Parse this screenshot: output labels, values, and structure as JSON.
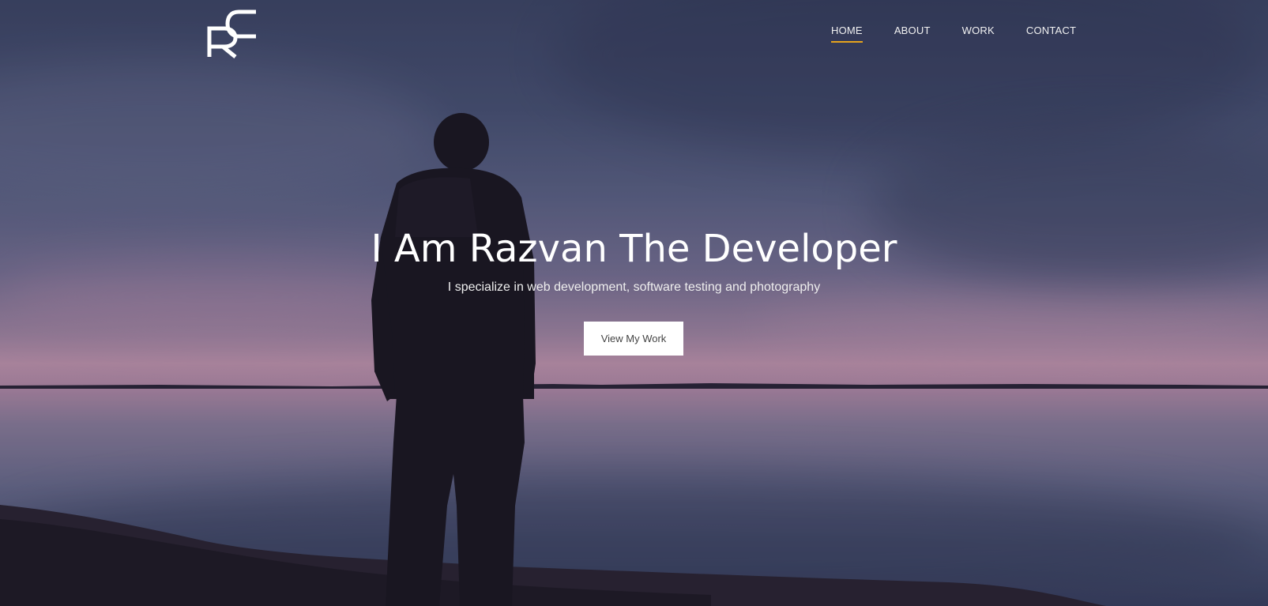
{
  "header": {
    "logo_letters": "RC",
    "nav": [
      {
        "label": "HOME",
        "active": true
      },
      {
        "label": "ABOUT",
        "active": false
      },
      {
        "label": "WORK",
        "active": false
      },
      {
        "label": "CONTACT",
        "active": false
      }
    ]
  },
  "hero": {
    "headline": "I Am Razvan The Developer",
    "subline": "I specialize in web development, software testing and photography",
    "cta_label": "View My Work"
  },
  "colors": {
    "accent": "#e6a31d",
    "text": "#ffffff",
    "button_bg": "#ffffff",
    "button_text": "#444444"
  }
}
